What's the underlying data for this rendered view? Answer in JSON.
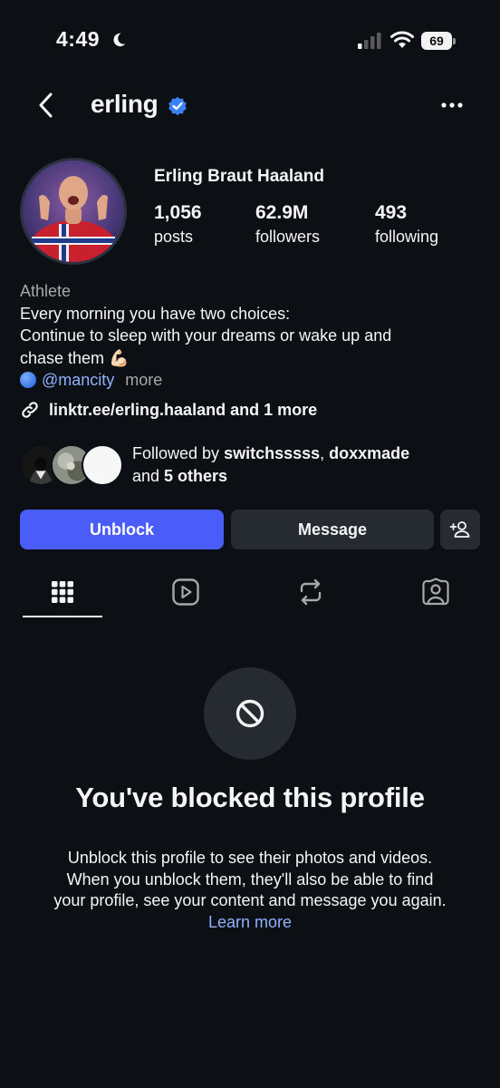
{
  "status_bar": {
    "time": "4:49",
    "battery": "69"
  },
  "header": {
    "username": "erling"
  },
  "profile": {
    "display_name": "Erling Braut Haaland",
    "stats": [
      {
        "value": "1,056",
        "label": "posts"
      },
      {
        "value": "62.9M",
        "label": "followers"
      },
      {
        "value": "493",
        "label": "following"
      }
    ],
    "category": "Athlete",
    "bio_lines": [
      "Every morning you have two choices:",
      "Continue to sleep with your dreams or wake up and",
      "chase them 💪🏻"
    ],
    "mention": "@mancity",
    "more_label": "more",
    "link": "linktr.ee/erling.haaland and 1 more"
  },
  "followed_by": {
    "prefix": "Followed by ",
    "user1": "switchsssss",
    "separator": ", ",
    "user2": "doxxmade",
    "and": "and ",
    "others": "5 others"
  },
  "actions": {
    "unblock_label": "Unblock",
    "message_label": "Message"
  },
  "blocked": {
    "title": "You've blocked this profile",
    "description": "Unblock this profile to see their photos and videos. When you unblock them, they'll also be able to find your profile, see your content and message you again.",
    "learn_more": "Learn more"
  },
  "colors": {
    "background": "#0c1014",
    "accent": "#4a5df9",
    "secondary_button": "#262a31",
    "link": "#8fb1ff",
    "verified": "#3b82f6"
  }
}
